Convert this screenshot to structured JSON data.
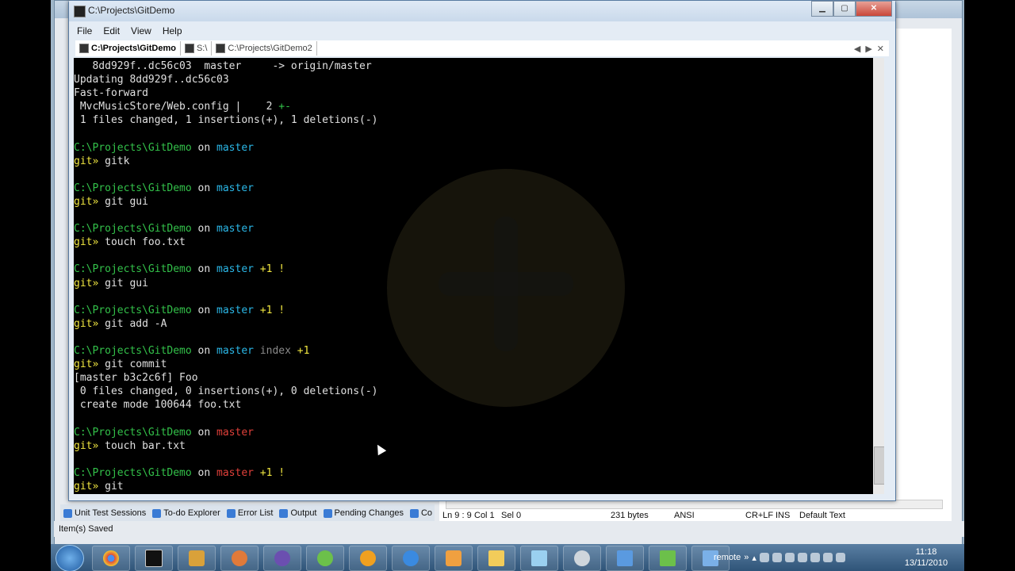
{
  "console": {
    "title": "C:\\Projects\\GitDemo",
    "menu": [
      "File",
      "Edit",
      "View",
      "Help"
    ],
    "tabs": [
      "C:\\Projects\\GitDemo",
      "S:\\",
      "C:\\Projects\\GitDemo2"
    ],
    "close": "✕",
    "nav_prev": "◀",
    "nav_next": "▶"
  },
  "terminal": {
    "lines": [
      [
        {
          "t": "   8dd929f..dc56c03  master     -> origin/master",
          "c": "on"
        }
      ],
      [
        {
          "t": "Updating 8dd929f..dc56c03",
          "c": "on"
        }
      ],
      [
        {
          "t": "Fast-forward",
          "c": "on"
        }
      ],
      [
        {
          "t": " MvcMusicStore/Web.config |    2 ",
          "c": "on"
        },
        {
          "t": "+-",
          "c": "grn"
        }
      ],
      [
        {
          "t": " 1 files changed, 1 insertions(+), 1 deletions(-)",
          "c": "on"
        }
      ],
      [],
      [
        {
          "t": "C:\\Projects\\GitDemo",
          "c": "path"
        },
        {
          "t": " on ",
          "c": "on"
        },
        {
          "t": "master",
          "c": "br"
        }
      ],
      [
        {
          "t": "git»",
          "c": "yel"
        },
        {
          "t": " gitk",
          "c": "on"
        }
      ],
      [],
      [
        {
          "t": "C:\\Projects\\GitDemo",
          "c": "path"
        },
        {
          "t": " on ",
          "c": "on"
        },
        {
          "t": "master",
          "c": "br"
        }
      ],
      [
        {
          "t": "git»",
          "c": "yel"
        },
        {
          "t": " git gui",
          "c": "on"
        }
      ],
      [],
      [
        {
          "t": "C:\\Projects\\GitDemo",
          "c": "path"
        },
        {
          "t": " on ",
          "c": "on"
        },
        {
          "t": "master",
          "c": "br"
        }
      ],
      [
        {
          "t": "git»",
          "c": "yel"
        },
        {
          "t": " touch foo.txt",
          "c": "on"
        }
      ],
      [],
      [
        {
          "t": "C:\\Projects\\GitDemo",
          "c": "path"
        },
        {
          "t": " on ",
          "c": "on"
        },
        {
          "t": "master",
          "c": "br"
        },
        {
          "t": " +1 !",
          "c": "yel"
        }
      ],
      [
        {
          "t": "git»",
          "c": "yel"
        },
        {
          "t": " git gui",
          "c": "on"
        }
      ],
      [],
      [
        {
          "t": "C:\\Projects\\GitDemo",
          "c": "path"
        },
        {
          "t": " on ",
          "c": "on"
        },
        {
          "t": "master",
          "c": "br"
        },
        {
          "t": " +1 !",
          "c": "yel"
        }
      ],
      [
        {
          "t": "git»",
          "c": "yel"
        },
        {
          "t": " git add -A",
          "c": "on"
        }
      ],
      [],
      [
        {
          "t": "C:\\Projects\\GitDemo",
          "c": "path"
        },
        {
          "t": " on ",
          "c": "on"
        },
        {
          "t": "master",
          "c": "br"
        },
        {
          "t": " index",
          "c": "gry"
        },
        {
          "t": " +1",
          "c": "yel"
        }
      ],
      [
        {
          "t": "git»",
          "c": "yel"
        },
        {
          "t": " git commit",
          "c": "on"
        }
      ],
      [
        {
          "t": "[master b3c2c6f] Foo",
          "c": "on"
        }
      ],
      [
        {
          "t": " 0 files changed, 0 insertions(+), 0 deletions(-)",
          "c": "on"
        }
      ],
      [
        {
          "t": " create mode 100644 foo.txt",
          "c": "on"
        }
      ],
      [],
      [
        {
          "t": "C:\\Projects\\GitDemo",
          "c": "path"
        },
        {
          "t": " on ",
          "c": "on"
        },
        {
          "t": "master",
          "c": "brr"
        }
      ],
      [
        {
          "t": "git»",
          "c": "yel"
        },
        {
          "t": " touch bar.txt",
          "c": "on"
        }
      ],
      [],
      [
        {
          "t": "C:\\Projects\\GitDemo",
          "c": "path"
        },
        {
          "t": " on ",
          "c": "on"
        },
        {
          "t": "master",
          "c": "brr"
        },
        {
          "t": " +1 !",
          "c": "yel"
        }
      ],
      [
        {
          "t": "git»",
          "c": "yel"
        },
        {
          "t": " git",
          "c": "on"
        }
      ]
    ]
  },
  "vs": {
    "tool_tabs": [
      "Unit Test Sessions",
      "To-do Explorer",
      "Error List",
      "Output",
      "Pending Changes",
      "Co"
    ],
    "status_left": "Item(s) Saved",
    "editor_status": [
      "Ln 9 : 9",
      "Col 1",
      "Sel 0",
      "231 bytes",
      "ANSI",
      "CR+LF",
      "INS",
      "Default Text"
    ]
  },
  "taskbar": {
    "tray_label": "remote",
    "time": "11:18",
    "date": "13/11/2010"
  },
  "colors": {
    "path": "#33c24a",
    "branch_clean": "#2bb8e8",
    "branch_dirty": "#e0403a",
    "prompt": "#f0e640"
  }
}
